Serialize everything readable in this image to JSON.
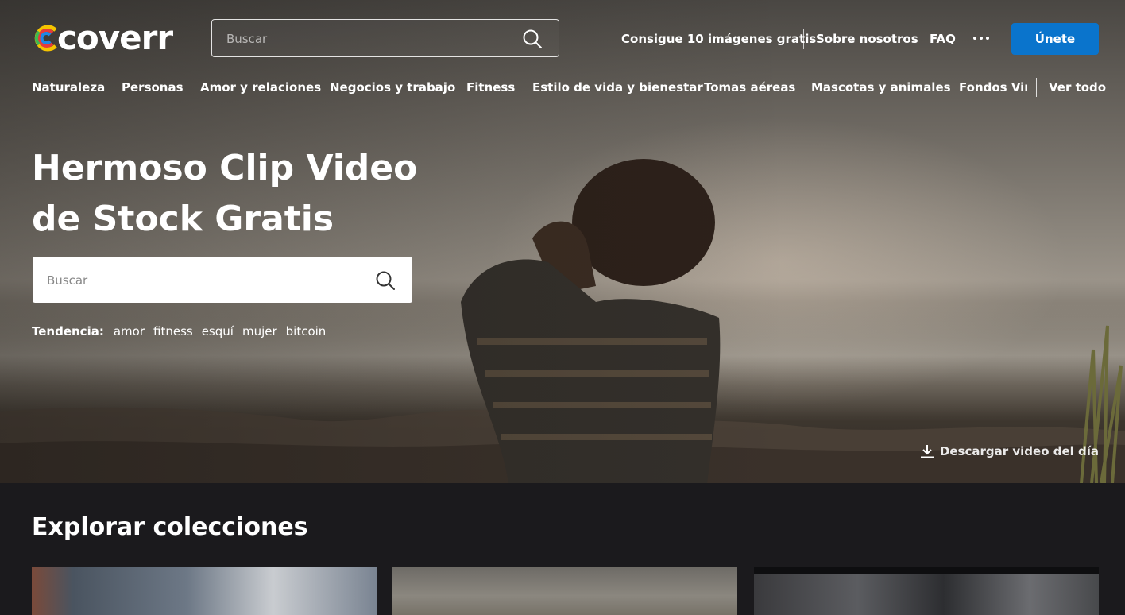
{
  "header": {
    "logo_text": "coverr",
    "search_placeholder": "Buscar",
    "links": [
      {
        "label": "Consigue 10 imágenes gratis"
      },
      {
        "label": "Sobre nosotros"
      },
      {
        "label": "FAQ"
      }
    ],
    "more_icon": "more-dots-icon",
    "join_label": "Únete",
    "accent_color": "#0a74cc"
  },
  "categories": [
    {
      "label": "Naturaleza"
    },
    {
      "label": "Personas"
    },
    {
      "label": "Amor y relaciones"
    },
    {
      "label": "Negocios y trabajo"
    },
    {
      "label": "Fitness"
    },
    {
      "label": "Estilo de vida y bienestar"
    },
    {
      "label": "Tomas aéreas"
    },
    {
      "label": "Mascotas y animales"
    },
    {
      "label": "Fondos Virtu"
    },
    {
      "label": "Ver todo"
    }
  ],
  "hero": {
    "title_line1": "Hermoso Clip Video",
    "title_line2": "de Stock Gratis",
    "search_placeholder": "Buscar",
    "trending_label": "Tendencia:",
    "trending": [
      "amor",
      "fitness",
      "esquí",
      "mujer",
      "bitcoin"
    ],
    "download_label": "Descargar video del día"
  },
  "collections": {
    "title": "Explorar colecciones"
  }
}
